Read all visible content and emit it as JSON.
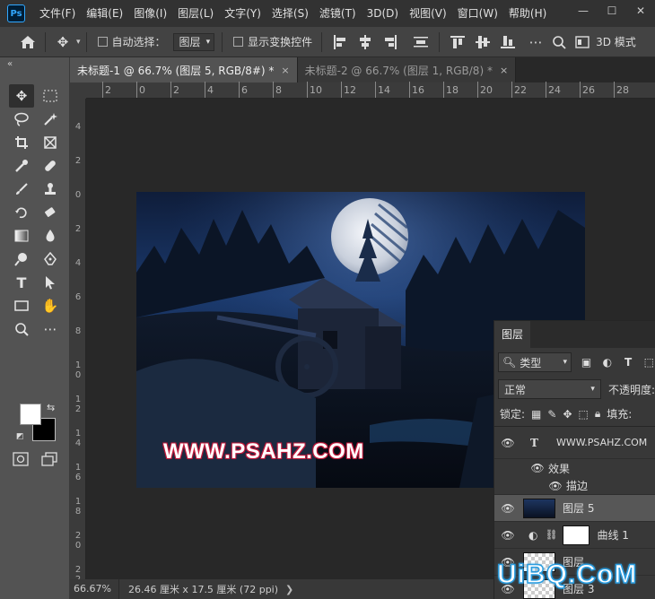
{
  "app": {
    "logo": "Ps"
  },
  "menu": [
    "文件(F)",
    "编辑(E)",
    "图像(I)",
    "图层(L)",
    "文字(Y)",
    "选择(S)",
    "滤镜(T)",
    "3D(D)",
    "视图(V)",
    "窗口(W)",
    "帮助(H)"
  ],
  "window_controls": {
    "minimize": "—",
    "restore": "☐",
    "close": "✕"
  },
  "options": {
    "auto_select_label": "自动选择：",
    "auto_select_target": "图层",
    "show_transform_label": "显示变换控件",
    "mode_3d_label": "3D 模式"
  },
  "tabs": [
    {
      "label": "未标题-1 @ 66.7% (图层 5, RGB/8#) *",
      "close": "×"
    },
    {
      "label": "未标题-2 @ 66.7% (图层 1, RGB/8) *",
      "close": "×"
    }
  ],
  "ruler_top": [
    "2",
    "0",
    "2",
    "4",
    "6",
    "8",
    "10",
    "12",
    "14",
    "16",
    "18",
    "20",
    "22",
    "24",
    "26",
    "28"
  ],
  "ruler_left": [
    "4",
    "2",
    "0",
    "2",
    "4",
    "6",
    "8",
    "1 0",
    "1 2",
    "1 4",
    "1 6",
    "1 8",
    "2 0",
    "2 2"
  ],
  "document": {
    "watermark_text": "WWW.PSAHZ.COM"
  },
  "status": {
    "zoom": "66.67%",
    "doc_info": "26.46 厘米 x 17.5 厘米 (72 ppi)",
    "arrow": "❯"
  },
  "layers_panel": {
    "tab_label": "图层",
    "filter_kind": "类型",
    "blend_mode": "正常",
    "opacity_label": "不透明度:",
    "lock_label": "锁定:",
    "fill_label": "填充:",
    "layers": [
      {
        "name": "WWW.PSAHZ.COM",
        "kind": "text"
      },
      {
        "name": "效果",
        "kind": "effects"
      },
      {
        "name": "描边",
        "kind": "effect-item"
      },
      {
        "name": "图层 5",
        "kind": "pixel",
        "selected": true
      },
      {
        "name": "曲线 1",
        "kind": "adjustment"
      },
      {
        "name": "图层",
        "kind": "pixel"
      },
      {
        "name": "图层 3",
        "kind": "pixel"
      }
    ]
  },
  "site_watermark": "UiBQ.CoM",
  "colors": {
    "foreground": "#ffffff",
    "background": "#000000",
    "watermark_stroke": "#c0183a",
    "uibq_blue": "#2a9de0"
  }
}
